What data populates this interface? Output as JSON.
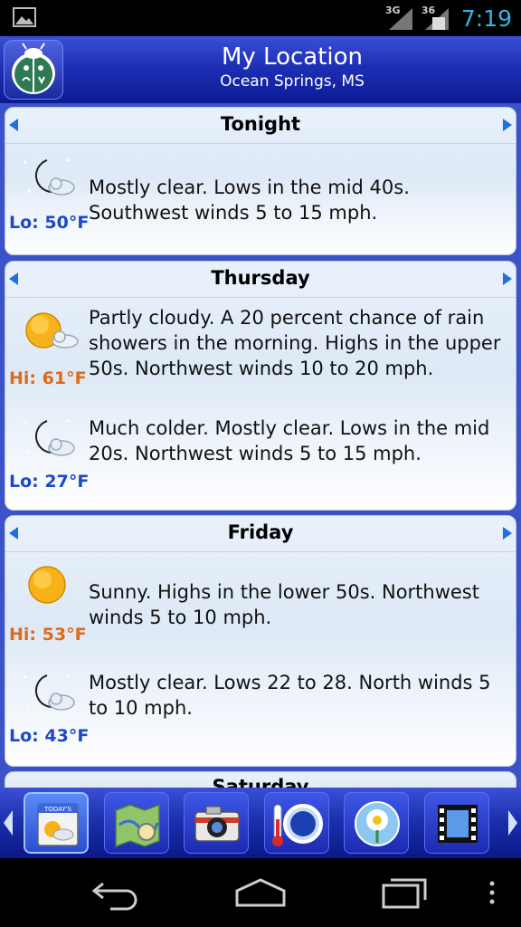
{
  "status_bar": {
    "network_1": "3G",
    "network_2": "36",
    "time": "7:19"
  },
  "header": {
    "title": "My Location",
    "subtitle": "Ocean Springs, MS",
    "logo_icon": "ladybug-logo-icon"
  },
  "forecast": [
    {
      "day": "Tonight",
      "periods": [
        {
          "icon": "moon-cloud-icon",
          "temp": "Lo: 50°F",
          "kind": "lo",
          "text": "Mostly clear. Lows in the mid 40s. Southwest winds 5 to 15 mph."
        }
      ]
    },
    {
      "day": "Thursday",
      "periods": [
        {
          "icon": "sun-cloud-icon",
          "temp": "Hi: 61°F",
          "kind": "hi",
          "text": "Partly cloudy. A 20 percent chance of rain showers in the morning. Highs in the upper 50s. Northwest winds 10 to 20 mph."
        },
        {
          "icon": "moon-cloud-icon",
          "temp": "Lo: 27°F",
          "kind": "lo",
          "text": "Much colder. Mostly clear. Lows in the mid 20s. Northwest winds 5 to 15 mph."
        }
      ]
    },
    {
      "day": "Friday",
      "periods": [
        {
          "icon": "sun-icon",
          "temp": "Hi: 53°F",
          "kind": "hi",
          "text": "Sunny. Highs in the lower 50s. Northwest winds 5 to 10 mph."
        },
        {
          "icon": "moon-cloud-icon",
          "temp": "Lo: 43°F",
          "kind": "lo",
          "text": "Mostly clear. Lows 22 to 28. North winds 5 to 10 mph."
        }
      ]
    },
    {
      "day": "Saturday",
      "periods": []
    }
  ],
  "toolbar": {
    "today_label": "TODAY'S",
    "buttons": [
      "today-icon",
      "map-icon",
      "camera-icon",
      "thermometer-gauge-icon",
      "flower-icon",
      "film-icon"
    ]
  },
  "colors": {
    "accent": "#33b5e5",
    "header": "#1d2fb5",
    "lo_temp": "#1d48c8",
    "hi_temp": "#e06a17"
  }
}
